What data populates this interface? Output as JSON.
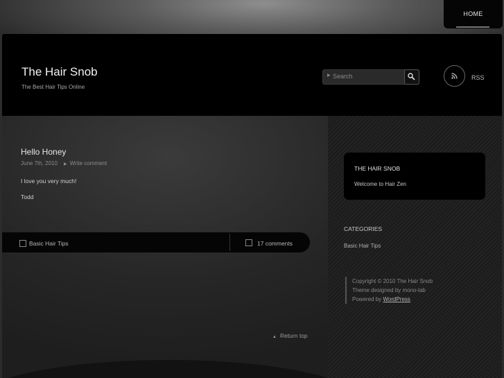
{
  "nav": {
    "home_label": "HOME"
  },
  "header": {
    "title": "The Hair Snob",
    "tagline": "The Best Hair Tips Online",
    "search_placeholder": "Search",
    "rss_label": "RSS"
  },
  "post": {
    "title": "Hello Honey",
    "date": "June 7th, 2010",
    "write_comment": "Write comment",
    "paragraphs": [
      "I love you very much!",
      "Todd"
    ],
    "category": "Basic Hair Tips",
    "comments": "17 comments"
  },
  "footer": {
    "return_top": "Return top"
  },
  "sidebar": {
    "box_title": "THE HAIR SNOB",
    "box_text": "Welcome to Hair Zen",
    "categories_title": "CATEGORIES",
    "categories": [
      "Basic Hair Tips"
    ],
    "copyright": "Copyright ©  2010  The Hair Snob",
    "theme_credit": "Theme designed by mono-lab",
    "powered_by": "Powered by",
    "wordpress": "WordPress"
  }
}
